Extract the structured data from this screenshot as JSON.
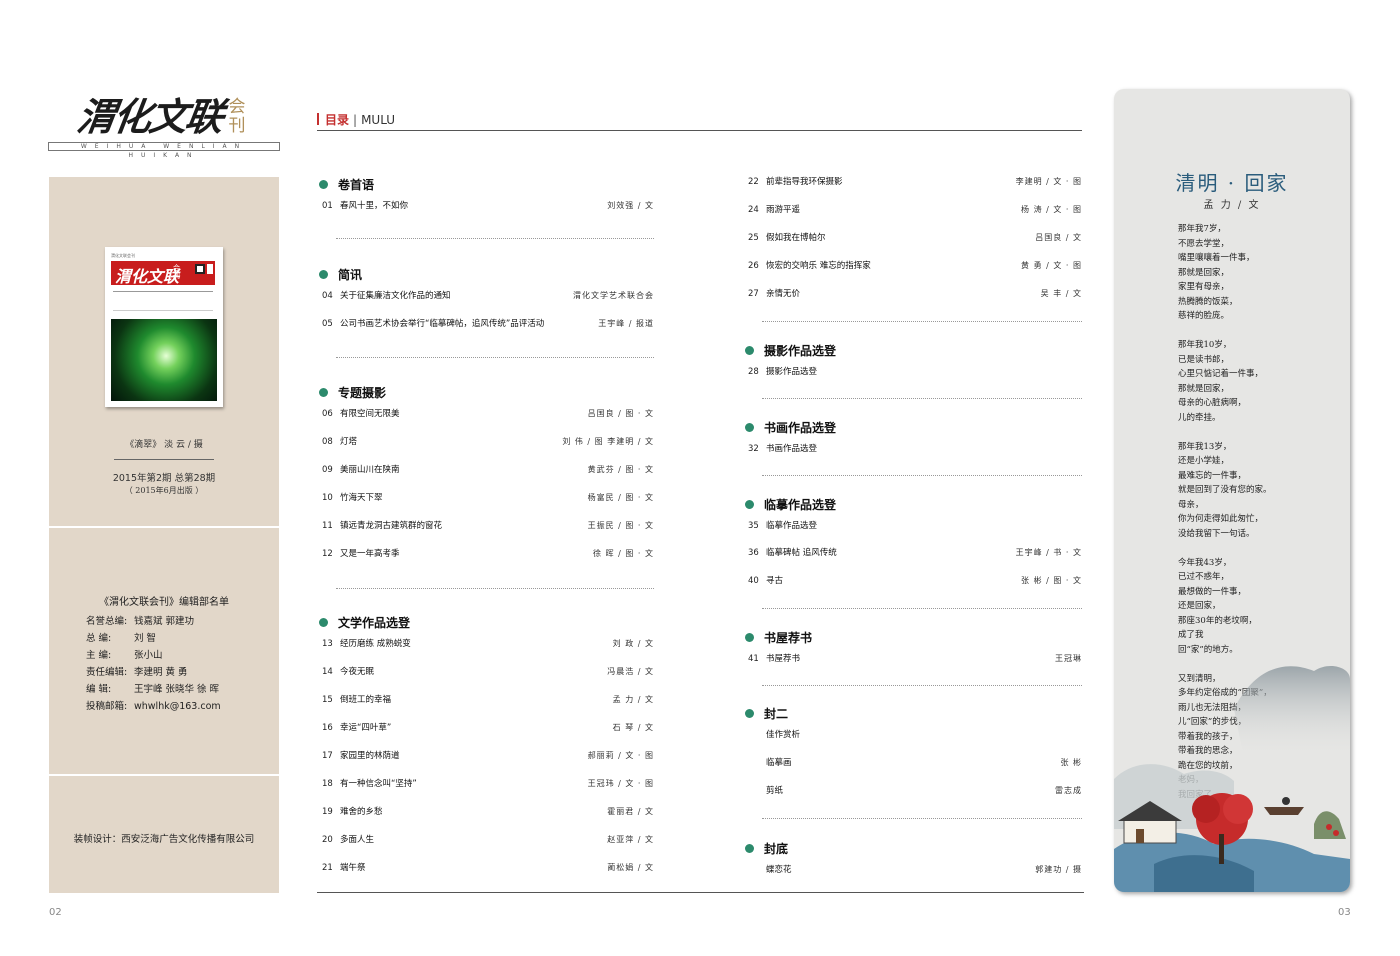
{
  "masthead": {
    "title": "渭化文联",
    "kan": "会刊",
    "pinyin": "WEIHUA WENLIAN HUIKAN"
  },
  "cover": {
    "top_text": "渭化文联会刊",
    "logo_text": "渭化文联",
    "logo_kan": "会刊",
    "issue_no": "2"
  },
  "left_panel": {
    "cover_caption": "《滴翠》 淡  云 / 摄",
    "issue": "2015年第2期  总第28期",
    "pubdate": "（ 2015年6月出版 ）",
    "staff_title": "《渭化文联会刊》编辑部名单",
    "staff": [
      {
        "role": "名誉总编:",
        "value": "钱嘉斌   郭建功"
      },
      {
        "role": "总    编:",
        "value": "刘  智"
      },
      {
        "role": "主    编:",
        "value": "张小山"
      },
      {
        "role": "责任编辑:",
        "value": "李建明   黄  勇"
      },
      {
        "role": "编    辑:",
        "value": "王宇峰  张晓华  徐  晖"
      },
      {
        "role": "投稿邮箱:",
        "value": "whwlhk@163.com"
      }
    ],
    "design": "装帧设计：西安泛海广告文化传播有限公司"
  },
  "page_numbers": {
    "left": "02",
    "right": "03"
  },
  "toc_header": {
    "cn": "目录",
    "sep": "|",
    "en": "MULU"
  },
  "toc_left": [
    {
      "title": "卷首语",
      "entries": [
        {
          "num": "01",
          "title": "春风十里，不如你",
          "author": "刘效强  /  文"
        }
      ]
    },
    {
      "title": "简讯",
      "entries": [
        {
          "num": "04",
          "title": "关于征集廉洁文化作品的通知",
          "author": "渭化文学艺术联合会"
        },
        {
          "num": "05",
          "title": "公司书画艺术协会举行“临摹碑帖，追风传统”品评活动",
          "author": "王宇峰  /  报道"
        }
      ]
    },
    {
      "title": "专题摄影",
      "entries": [
        {
          "num": "06",
          "title": "有限空间无限美",
          "author": "吕国良  /  图 · 文"
        },
        {
          "num": "08",
          "title": "灯塔",
          "author": "刘  伟 / 图   李建明  /  文"
        },
        {
          "num": "09",
          "title": "美丽山川在陕南",
          "author": "黄武芬  /  图 · 文"
        },
        {
          "num": "10",
          "title": "竹海天下翠",
          "author": "杨富民  /  图 · 文"
        },
        {
          "num": "11",
          "title": "镇远青龙洞古建筑群的窗花",
          "author": "王振民  /  图 · 文"
        },
        {
          "num": "12",
          "title": "又是一年高考季",
          "author": "徐  晖  /  图 · 文"
        }
      ]
    },
    {
      "title": "文学作品选登",
      "entries": [
        {
          "num": "13",
          "title": "经历磨练 成熟蜕变",
          "author": "刘  政  /  文"
        },
        {
          "num": "14",
          "title": "今夜无眠",
          "author": "冯晨浩  /  文"
        },
        {
          "num": "15",
          "title": "倒班工的幸福",
          "author": "孟  力  /  文"
        },
        {
          "num": "16",
          "title": "幸运“四叶草”",
          "author": "石  琴  /  文"
        },
        {
          "num": "17",
          "title": "家园里的林荫道",
          "author": "郝丽莉  /  文 · 图"
        },
        {
          "num": "18",
          "title": "有一种信念叫“坚持”",
          "author": "王冠玮  /  文 · 图"
        },
        {
          "num": "19",
          "title": "难舍的乡愁",
          "author": "霍丽君  /  文"
        },
        {
          "num": "20",
          "title": "多面人生",
          "author": "赵亚萍  /  文"
        },
        {
          "num": "21",
          "title": "端午祭",
          "author": "蔺松娟  /  文"
        }
      ]
    }
  ],
  "toc_right_top": [
    {
      "num": "22",
      "title": "前辈指导我环保摄影",
      "author": "李建明  /  文 · 图"
    },
    {
      "num": "24",
      "title": "雨游平遥",
      "author": "杨  涛  /  文 · 图"
    },
    {
      "num": "25",
      "title": "假如我在博帕尔",
      "author": "吕国良  /  文"
    },
    {
      "num": "26",
      "title": "恢宏的交响乐  难忘的指挥家",
      "author": "黄  勇  /  文 · 图"
    },
    {
      "num": "27",
      "title": "亲情无价",
      "author": "吴  丰  /  文"
    }
  ],
  "toc_right": [
    {
      "title": "摄影作品选登",
      "entries": [
        {
          "num": "28",
          "title": "摄影作品选登",
          "author": ""
        }
      ]
    },
    {
      "title": "书画作品选登",
      "entries": [
        {
          "num": "32",
          "title": "书画作品选登",
          "author": ""
        }
      ]
    },
    {
      "title": "临摹作品选登",
      "entries": [
        {
          "num": "35",
          "title": "临摹作品选登",
          "author": ""
        },
        {
          "num": "36",
          "title": "临摹碑帖 追风传统",
          "author": "王宇峰  /  书 · 文"
        },
        {
          "num": "40",
          "title": "寻古",
          "author": "张  彬  /  图 · 文"
        }
      ]
    },
    {
      "title": "书屋荐书",
      "entries": [
        {
          "num": "41",
          "title": "书屋荐书",
          "author": "王冠琳"
        }
      ]
    },
    {
      "title": "封二",
      "entries": [
        {
          "num": "",
          "title": "佳作赏析",
          "author": ""
        },
        {
          "num": "",
          "title": "临摹画",
          "author": "张  彬"
        },
        {
          "num": "",
          "title": "剪纸",
          "author": "雷志成"
        }
      ]
    },
    {
      "title": "封底",
      "entries": [
        {
          "num": "",
          "title": "蝶恋花",
          "author": "郭建功  /  摄"
        }
      ]
    }
  ],
  "poem": {
    "title": "清明 · 回家",
    "author": "孟  力 / 文",
    "stanzas": [
      [
        "那年我7岁，",
        "不愿去学堂，",
        "嘴里嚷嚷着一件事，",
        "那就是回家，",
        "家里有母亲，",
        "热腾腾的饭菜，",
        "慈祥的脸庞。"
      ],
      [
        "那年我10岁，",
        "已是读书郎，",
        "心里只惦记着一件事，",
        "那就是回家，",
        "母亲的心脏病啊，",
        "儿的牵挂。"
      ],
      [
        "那年我13岁，",
        "还是小学娃，",
        "最难忘的一件事，",
        "就是回到了没有您的家。",
        "母亲，",
        "你为何走得如此匆忙，",
        "没给我留下一句话。"
      ],
      [
        "今年我43岁，",
        "已过不惑年，",
        "最想做的一件事，",
        "还是回家，",
        "那座30年的老坟啊，",
        "成了我",
        "回“家”的地方。"
      ],
      [
        "又到清明，",
        "多年约定俗成的“团聚”，",
        "雨儿也无法阻挡，",
        "儿“回家”的步伐，",
        "带着我的孩子，",
        "带着我的思念，",
        "跪在您的坟前，",
        "老妈，",
        "我回家了。"
      ]
    ]
  },
  "colors": {
    "accent_red": "#c4302f",
    "section_dot": "#2c8a6c",
    "left_panel_bg": "#e2d7c9",
    "poem_panel_bg": "#e6e6e4",
    "poem_title": "#2a5c7c"
  }
}
